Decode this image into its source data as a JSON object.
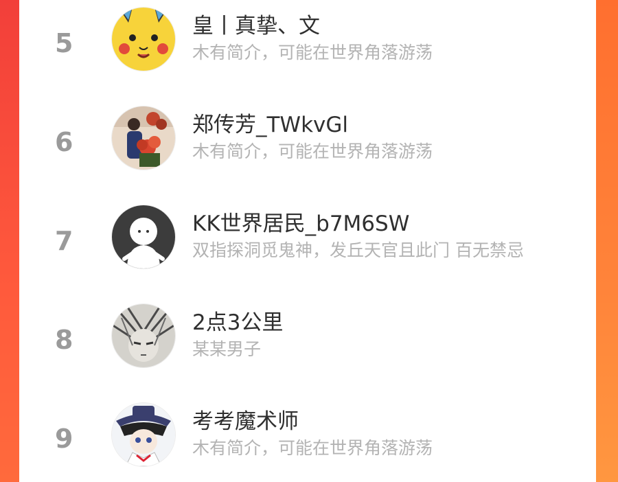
{
  "colors": {
    "accent_left": "#f23f3a",
    "accent_right": "#ff9740",
    "rank": "#9a9a9a",
    "name": "#2f2f2f",
    "bio": "#b3b3b3"
  },
  "list": {
    "rows": [
      {
        "rank": "5",
        "name": "皇丨真挚、文",
        "bio": "木有简介，可能在世界角落游荡",
        "avatar_icon": "pikachu-avatar"
      },
      {
        "rank": "6",
        "name": "郑传芳_TWkvGl",
        "bio": "木有简介，可能在世界角落游荡",
        "avatar_icon": "flowers-photo-avatar"
      },
      {
        "rank": "7",
        "name": "KK世界居民_b7M6SW",
        "bio": "双指探洞觅鬼神，发丘天官且此门 百无禁忌",
        "avatar_icon": "default-user-avatar"
      },
      {
        "rank": "8",
        "name": "2点3公里",
        "bio": "某某男子",
        "avatar_icon": "anime-sketch-avatar"
      },
      {
        "rank": "9",
        "name": "考考魔术师",
        "bio": "木有简介，可能在世界角落游荡",
        "avatar_icon": "magician-anime-avatar"
      }
    ]
  }
}
